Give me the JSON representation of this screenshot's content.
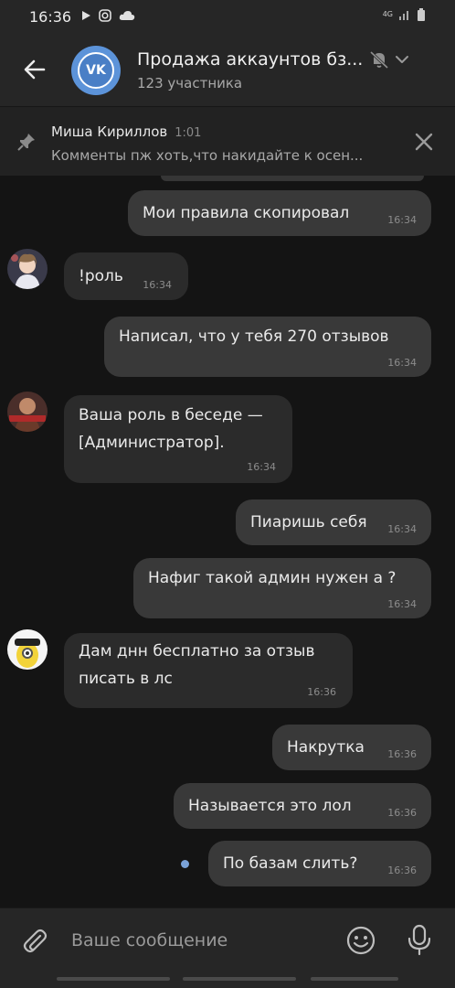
{
  "status_bar": {
    "time": "16:36",
    "network": "4G",
    "icons_left": [
      "play-icon",
      "instagram-icon",
      "cloud-icon"
    ],
    "icons_right": [
      "network-4g-icon",
      "signal-icon",
      "battery-icon"
    ]
  },
  "header": {
    "title": "Продажа аккаунтов бз...",
    "subtitle": "123 участника",
    "avatar_label": "VK"
  },
  "pinned": {
    "author": "Миша Кириллов",
    "time": "1:01",
    "text": "Комменты пж хоть,что накидайте к осен..."
  },
  "messages": [
    {
      "direction": "out",
      "text": "Мои правила скопировал",
      "time": "16:34"
    },
    {
      "direction": "in",
      "text": "!роль",
      "time": "16:34",
      "avatar": "anime-avatar"
    },
    {
      "direction": "out",
      "text": "Написал, что у тебя 270 отзывов",
      "time": "16:34"
    },
    {
      "direction": "in",
      "text_line1": "Ваша роль в беседе —",
      "text_line2": "[Администратор].",
      "time": "16:34",
      "avatar": "bot-avatar"
    },
    {
      "direction": "out",
      "text": "Пиаришь себя",
      "time": "16:34"
    },
    {
      "direction": "out",
      "text": "Нафиг такой админ нужен а ?",
      "time": "16:34"
    },
    {
      "direction": "in",
      "text_line1": "Дам днн бесплатно за отзыв",
      "text_line2": "писать в лс",
      "time": "16:36",
      "avatar": "minion-avatar"
    },
    {
      "direction": "out",
      "text": "Накрутка",
      "time": "16:36"
    },
    {
      "direction": "out",
      "text": "Называется это лол",
      "time": "16:36"
    },
    {
      "direction": "out",
      "text": "По базам слить?",
      "time": "16:36",
      "unread": true
    }
  ],
  "composer": {
    "placeholder": "Ваше сообщение"
  },
  "colors": {
    "background": "#141414",
    "bar": "#262626",
    "bubble_out": "#393939",
    "bubble_in": "#2b2b2b",
    "accent": "#5c93d9"
  }
}
